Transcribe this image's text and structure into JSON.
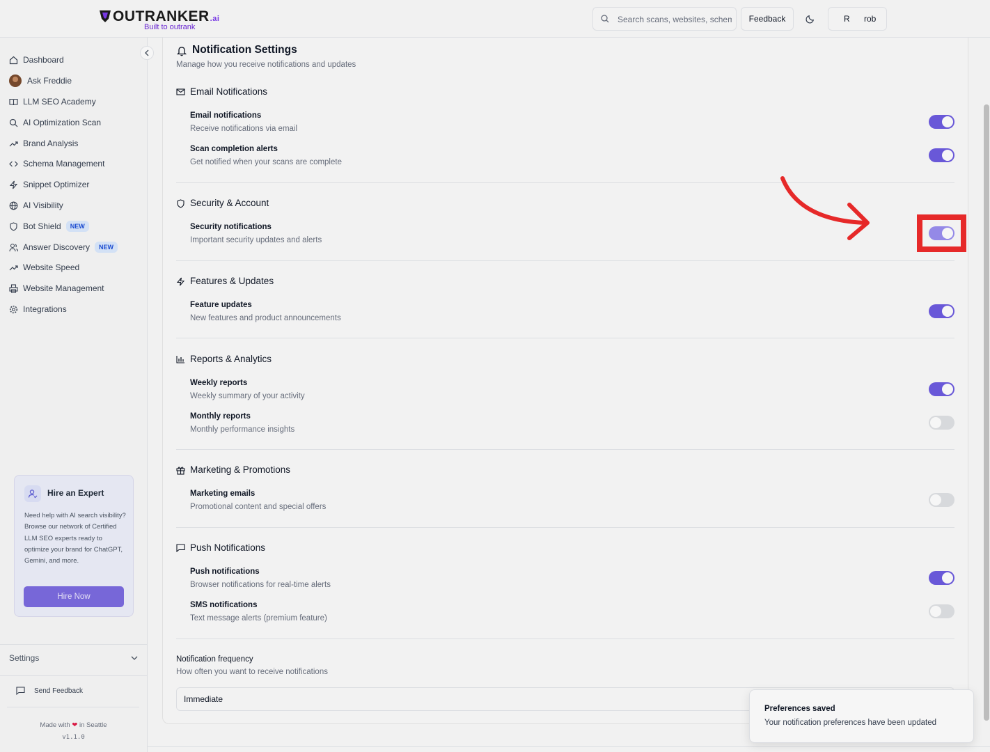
{
  "header": {
    "logo_main": "OUTRANKER",
    "logo_ai": ".ai",
    "logo_tagline": "Built to outrank",
    "search_placeholder": "Search scans, websites, schemas...",
    "feedback_label": "Feedback",
    "user_initial": "R",
    "user_name": "rob"
  },
  "sidebar": {
    "items": [
      {
        "label": "Dashboard",
        "icon": "home-icon"
      },
      {
        "label": "Ask Freddie",
        "icon": "avatar"
      },
      {
        "label": "LLM SEO Academy",
        "icon": "book-icon"
      },
      {
        "label": "AI Optimization Scan",
        "icon": "search-icon"
      },
      {
        "label": "Brand Analysis",
        "icon": "trending-icon"
      },
      {
        "label": "Schema Management",
        "icon": "code-icon"
      },
      {
        "label": "Snippet Optimizer",
        "icon": "bolt-icon"
      },
      {
        "label": "AI Visibility",
        "icon": "globe-icon"
      },
      {
        "label": "Bot Shield",
        "icon": "shield-icon",
        "badge": "NEW"
      },
      {
        "label": "Answer Discovery",
        "icon": "users-icon",
        "badge": "NEW"
      },
      {
        "label": "Website Speed",
        "icon": "trending-icon"
      },
      {
        "label": "Website Management",
        "icon": "printer-icon"
      },
      {
        "label": "Integrations",
        "icon": "gear-icon"
      }
    ],
    "hire": {
      "title": "Hire an Expert",
      "text": "Need help with AI search visibility? Browse our network of Certified LLM SEO experts ready to optimize your brand for ChatGPT, Gemini, and more.",
      "button": "Hire Now"
    },
    "settings_label": "Settings",
    "send_feedback": "Send Feedback",
    "made_with_prefix": "Made with",
    "made_with_suffix": "in Seattle",
    "version": "v1.1.0"
  },
  "main": {
    "title": "Notification Settings",
    "description": "Manage how you receive notifications and updates",
    "sections": [
      {
        "title": "Email Notifications",
        "icon": "mail-icon",
        "rows": [
          {
            "title": "Email notifications",
            "desc": "Receive notifications via email",
            "on": true
          },
          {
            "title": "Scan completion alerts",
            "desc": "Get notified when your scans are complete",
            "on": true
          }
        ]
      },
      {
        "title": "Security & Account",
        "icon": "shield-icon",
        "rows": [
          {
            "title": "Security notifications",
            "desc": "Important security updates and alerts",
            "on": true
          }
        ]
      },
      {
        "title": "Features & Updates",
        "icon": "bolt-icon",
        "rows": [
          {
            "title": "Feature updates",
            "desc": "New features and product announcements",
            "on": true
          }
        ]
      },
      {
        "title": "Reports & Analytics",
        "icon": "bar-chart-icon",
        "rows": [
          {
            "title": "Weekly reports",
            "desc": "Weekly summary of your activity",
            "on": true
          },
          {
            "title": "Monthly reports",
            "desc": "Monthly performance insights",
            "on": false
          }
        ]
      },
      {
        "title": "Marketing & Promotions",
        "icon": "gift-icon",
        "rows": [
          {
            "title": "Marketing emails",
            "desc": "Promotional content and special offers",
            "on": false
          }
        ]
      },
      {
        "title": "Push Notifications",
        "icon": "message-icon",
        "rows": [
          {
            "title": "Push notifications",
            "desc": "Browser notifications for real-time alerts",
            "on": true
          },
          {
            "title": "SMS notifications",
            "desc": "Text message alerts (premium feature)",
            "on": false
          }
        ]
      }
    ],
    "frequency": {
      "title": "Notification frequency",
      "desc": "How often you want to receive notifications",
      "value": "Immediate"
    }
  },
  "toast": {
    "title": "Preferences saved",
    "desc": "Your notification preferences have been updated"
  },
  "colors": {
    "accent": "#6d5ce0",
    "highlight": "#ef2b2b"
  }
}
